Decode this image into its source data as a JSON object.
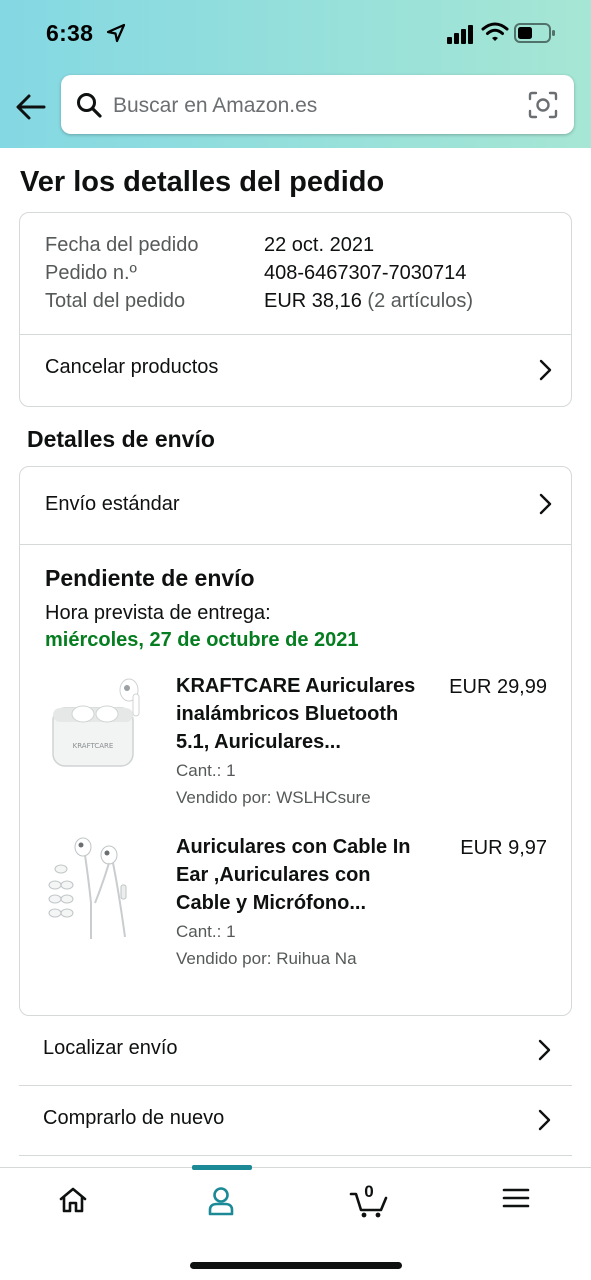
{
  "status_bar": {
    "time": "6:38"
  },
  "header": {
    "search_placeholder": "Buscar en Amazon.es"
  },
  "page": {
    "title": "Ver los detalles del pedido"
  },
  "order_summary": {
    "rows": [
      {
        "label": "Fecha del pedido",
        "value": "22 oct. 2021"
      },
      {
        "label": "Pedido n.º",
        "value": "408-6467307-7030714"
      },
      {
        "label": "Total del pedido",
        "value": "EUR 38,16",
        "extra": "(2 artículos)"
      }
    ],
    "cancel_label": "Cancelar productos"
  },
  "shipping": {
    "section_title": "Detalles de envío",
    "method": "Envío estándar",
    "status": "Pendiente de envío",
    "eta_label": "Hora prevista de entrega:",
    "eta_date": "miércoles, 27 de octubre de 2021",
    "items": [
      {
        "title_lines": [
          "KRAFTCARE Auriculares",
          "inalámbricos Bluetooth",
          "5.1, Auriculares..."
        ],
        "price": "EUR 29,99",
        "qty": "Cant.: 1",
        "seller": "Vendido por: WSLHCsure",
        "image_text": "KRAFTCARE"
      },
      {
        "title_lines": [
          "Auriculares con Cable In",
          "Ear ,Auriculares con",
          "Cable y Micrófono..."
        ],
        "price": "EUR 9,97",
        "qty": "Cant.: 1",
        "seller": "Vendido por: Ruihua Na"
      }
    ]
  },
  "actions": [
    {
      "label": "Localizar envío"
    },
    {
      "label": "Comprarlo de nuevo"
    }
  ],
  "tabbar": {
    "cart_count": "0",
    "active_tab": "account",
    "accent_color": "#1b8a96"
  },
  "colors": {
    "eta": "#067d20",
    "header_gradient": [
      "#84d8e3",
      "#a6e6d4"
    ]
  }
}
